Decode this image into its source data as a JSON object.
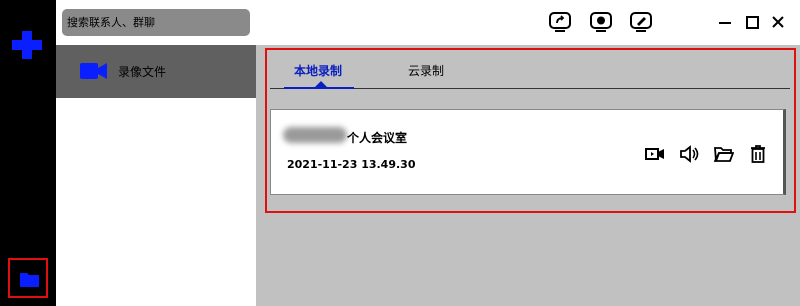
{
  "search": {
    "placeholder": "搜索联系人、群聊"
  },
  "sidebar": {
    "items": [
      {
        "label": "录像文件",
        "icon": "video-camera-icon"
      }
    ]
  },
  "tabs": [
    {
      "label": "本地录制",
      "active": true
    },
    {
      "label": "云录制",
      "active": false
    }
  ],
  "recording": {
    "title": "个人会议室",
    "timestamp": "2021-11-23 13.49.30"
  },
  "colors": {
    "accent": "#0a1fbf",
    "highlight": "#e01010",
    "rail": "#000000",
    "main_bg": "#c1c1c1"
  }
}
